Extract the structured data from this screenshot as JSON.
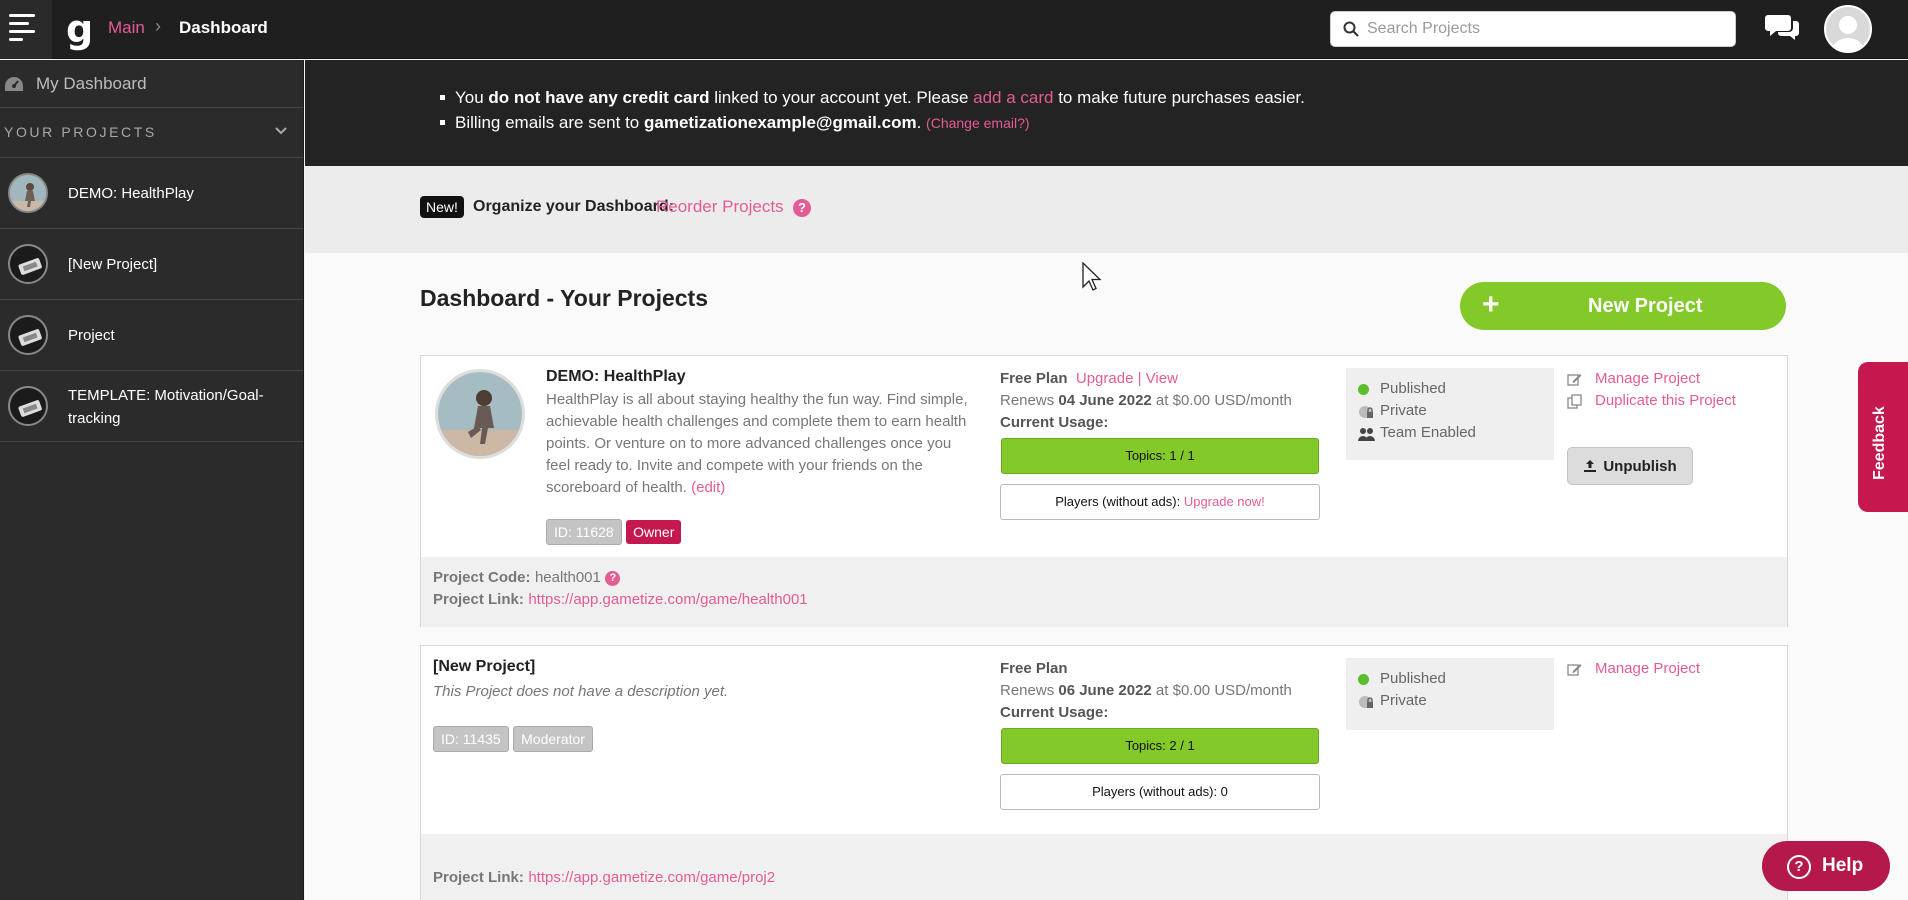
{
  "topbar": {
    "breadcrumb_main": "Main",
    "breadcrumb_current": "Dashboard",
    "search_placeholder": "Search Projects"
  },
  "sidebar": {
    "dashboard_label": "My Dashboard",
    "projects_heading": "YOUR PROJECTS",
    "items": [
      {
        "label": "DEMO: HealthPlay"
      },
      {
        "label": "[New Project]"
      },
      {
        "label": "Project"
      },
      {
        "label": "TEMPLATE: Motivation/Goal-tracking"
      }
    ]
  },
  "notice": {
    "line1_a": "You ",
    "line1_b": "do not have any credit card",
    "line1_c": " linked to your account yet. Please ",
    "line1_link": "add a card",
    "line1_d": " to make future purchases easier.",
    "line2_a": "Billing emails are sent to ",
    "line2_email": "gametizationexample@gmail.com",
    "line2_b": ". ",
    "line2_link": "(Change email?)"
  },
  "reorder": {
    "badge": "New!",
    "label": "Organize your Dashboard:",
    "link": "Reorder Projects"
  },
  "main": {
    "title": "Dashboard - Your Projects",
    "new_project_label": "New Project"
  },
  "projects": [
    {
      "name": "DEMO: HealthPlay",
      "description": "HealthPlay is all about staying healthy the fun way. Find simple, achievable health challenges and complete them to earn health points. Or venture on to more advanced challenges once you feel ready to. Invite and compete with your friends on the scoreboard of health.",
      "edit_link": "(edit)",
      "id_tag": "ID: 11628",
      "role_tag": "Owner",
      "plan_label": "Free Plan",
      "upgrade_link": "Upgrade",
      "plan_sep": "|",
      "view_link": "View",
      "renews_prefix": "Renews ",
      "renews_date": "04 June 2022",
      "renews_suffix": " at $0.00 USD/month",
      "usage_label": "Current Usage:",
      "topics": "Topics: 1 / 1",
      "players_prefix": "Players (without ads): ",
      "players_link": "Upgrade now!",
      "status_published": "Published",
      "status_private": "Private",
      "status_team": "Team Enabled",
      "manage_link": "Manage Project",
      "duplicate_link": "Duplicate this Project",
      "unpublish_label": "Unpublish",
      "code_label": "Project Code:",
      "code_value": "health001",
      "link_label": "Project Link:",
      "link_value": "https://app.gametize.com/game/health001"
    },
    {
      "name": "[New Project]",
      "description": "This Project does not have a description yet.",
      "id_tag": "ID: 11435",
      "role_tag": "Moderator",
      "plan_label": "Free Plan",
      "renews_prefix": "Renews ",
      "renews_date": "06 June 2022",
      "renews_suffix": " at $0.00 USD/month",
      "usage_label": "Current Usage:",
      "topics": "Topics: 2 / 1",
      "players": "Players (without ads): 0",
      "status_published": "Published",
      "status_private": "Private",
      "manage_link": "Manage Project",
      "link_label": "Project Link:",
      "link_value": "https://app.gametize.com/game/proj2"
    }
  ],
  "widgets": {
    "feedback": "Feedback",
    "help": "Help"
  },
  "colors": {
    "accent_pink": "#e45c93",
    "crimson": "#c4184f",
    "green": "#83c92a",
    "dark_bg": "#232323"
  }
}
